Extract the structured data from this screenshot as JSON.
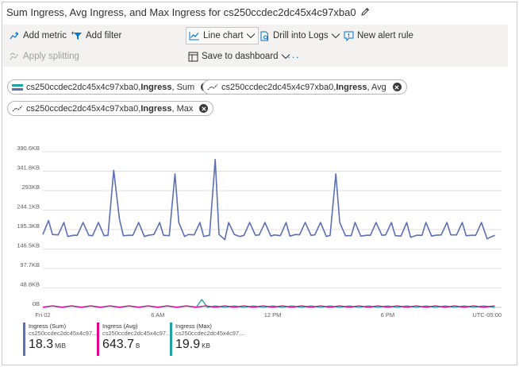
{
  "header": {
    "title": "Sum Ingress, Avg Ingress, and Max Ingress for cs250ccdec2dc45x4c97xba0"
  },
  "toolbar": {
    "add_metric": "Add metric",
    "add_filter": "Add filter",
    "apply_splitting": "Apply splitting",
    "line_chart": "Line chart",
    "drill_into_logs": "Drill into Logs",
    "new_alert_rule": "New alert rule",
    "save_to_dashboard": "Save to dashboard",
    "more": "···"
  },
  "pills": [
    {
      "resource": "cs250ccdec2dc45x4c97xba0, ",
      "metric": "Ingress",
      "agg": ", Sum"
    },
    {
      "resource": "cs250ccdec2dc45x4c97xba0, ",
      "metric": "Ingress",
      "agg": ", Avg"
    },
    {
      "resource": "cs250ccdec2dc45x4c97xba0, ",
      "metric": "Ingress",
      "agg": ", Max"
    }
  ],
  "colors": {
    "sum": "#5b6fb4",
    "avg": "#e3008c",
    "max": "#1ea3a3",
    "accent": "#0078d4"
  },
  "chart_data": {
    "type": "line",
    "y_ticks": [
      "390.6KB",
      "341.8KB",
      "293KB",
      "244.1KB",
      "195.3KB",
      "146.5KB",
      "97.7KB",
      "48.8KB",
      "0B"
    ],
    "y_tick_values": [
      390.6,
      341.8,
      293,
      244.1,
      195.3,
      146.5,
      97.7,
      48.8,
      0
    ],
    "ylim": [
      0,
      390.6
    ],
    "y_unit": "KB",
    "x_ticks": [
      {
        "label": "Fri 02",
        "hour": 0
      },
      {
        "label": "6 AM",
        "hour": 6
      },
      {
        "label": "12 PM",
        "hour": 12
      },
      {
        "label": "6 PM",
        "hour": 18
      }
    ],
    "xlim_hours": [
      0,
      23.95
    ],
    "timezone": "UTC-05:00",
    "grid": true,
    "series": [
      {
        "name": "Ingress (Sum)",
        "x": [
          0.0,
          0.3,
          0.5,
          0.8,
          1.1,
          1.3,
          1.6,
          1.8,
          2.1,
          2.4,
          2.6,
          2.9,
          3.2,
          3.4,
          3.7,
          4.0,
          4.2,
          4.5,
          4.7,
          5.0,
          5.3,
          5.5,
          5.8,
          6.1,
          6.3,
          6.6,
          6.9,
          7.1,
          7.4,
          7.6,
          7.9,
          8.2,
          8.4,
          8.7,
          9.0,
          9.2,
          9.5,
          9.7,
          10.0,
          10.3,
          10.5,
          10.8,
          11.1,
          11.3,
          11.6,
          11.9,
          12.1,
          12.4,
          12.7,
          12.9,
          13.2,
          13.4,
          13.7,
          14.0,
          14.2,
          14.5,
          14.8,
          15.0,
          15.3,
          15.5,
          15.8,
          16.1,
          16.3,
          16.6,
          16.9,
          17.1,
          17.4,
          17.7,
          17.9,
          18.2,
          18.4,
          18.7,
          19.0,
          19.2,
          19.5,
          19.8,
          20.0,
          20.3,
          20.5,
          20.8,
          21.1,
          21.3,
          21.6,
          21.9,
          22.1,
          22.4,
          22.6,
          22.9,
          23.2,
          23.4,
          23.6
        ],
        "y": [
          183,
          218,
          183,
          182,
          213,
          178,
          181,
          181,
          213,
          181,
          180,
          213,
          180,
          181,
          344,
          222,
          180,
          181,
          181,
          213,
          178,
          181,
          183,
          213,
          181,
          180,
          335,
          213,
          178,
          183,
          182,
          213,
          178,
          181,
          371,
          183,
          170,
          213,
          183,
          178,
          181,
          213,
          181,
          182,
          213,
          179,
          182,
          180,
          213,
          179,
          183,
          182,
          213,
          181,
          182,
          213,
          178,
          181,
          335,
          213,
          180,
          180,
          213,
          179,
          181,
          181,
          213,
          181,
          182,
          213,
          180,
          179,
          213,
          176,
          181,
          181,
          213,
          179,
          181,
          182,
          213,
          182,
          182,
          213,
          180,
          181,
          181,
          213,
          172,
          177,
          181
        ],
        "value": "18.3",
        "unit": "MiB",
        "sub": "cs250ccdec2dc45x4c97..."
      },
      {
        "name": "Ingress (Avg)",
        "x": [
          0.0,
          0.5,
          1.0,
          1.5,
          2.0,
          2.5,
          3.0,
          3.5,
          4.0,
          4.5,
          5.0,
          5.5,
          6.0,
          6.5,
          7.0,
          7.5,
          8.0,
          8.5,
          9.0,
          9.5,
          10.0,
          10.5,
          11.0,
          11.5,
          12.0,
          12.5,
          13.0,
          13.5,
          14.0,
          14.5,
          15.0,
          15.5,
          16.0,
          16.5,
          17.0,
          17.5,
          18.0,
          18.5,
          19.0,
          19.5,
          20.0,
          20.5,
          21.0,
          21.5,
          22.0,
          22.5,
          23.0,
          23.6
        ],
        "y": [
          0.6,
          4,
          0.6,
          4,
          0.6,
          4,
          0.6,
          4,
          0.6,
          4,
          0.6,
          4,
          0.6,
          4,
          0.6,
          4,
          0.6,
          4,
          0.6,
          4,
          0.6,
          4,
          0.6,
          4,
          0.6,
          4,
          0.6,
          4,
          0.6,
          4,
          0.6,
          4,
          0.6,
          4,
          0.6,
          4,
          0.6,
          4,
          0.6,
          4,
          0.6,
          4,
          0.6,
          4,
          0.6,
          4,
          0.6,
          4
        ],
        "value": "643.7",
        "unit": "B",
        "sub": "cs250ccdec2dc45x4c97..."
      },
      {
        "name": "Ingress (Max)",
        "x": [
          0.0,
          0.5,
          1.0,
          1.5,
          2.0,
          2.5,
          3.0,
          3.5,
          4.0,
          4.5,
          5.0,
          5.5,
          6.0,
          6.5,
          7.0,
          7.5,
          8.0,
          8.3,
          8.6,
          9.0,
          9.5,
          10.0,
          10.5,
          11.0,
          11.5,
          12.0,
          12.5,
          13.0,
          13.5,
          14.0,
          14.5,
          15.0,
          15.5,
          16.0,
          16.5,
          17.0,
          17.5,
          18.0,
          18.5,
          19.0,
          19.5,
          20.0,
          20.5,
          21.0,
          21.5,
          22.0,
          22.5,
          23.0,
          23.6
        ],
        "y": [
          0,
          4,
          0,
          4,
          0,
          4,
          0,
          4,
          0,
          4,
          0,
          4,
          0,
          4,
          0,
          4,
          0,
          20,
          0,
          4,
          0,
          4,
          0,
          4,
          0,
          4,
          0,
          4,
          0,
          4,
          0,
          4,
          0,
          4,
          0,
          4,
          0,
          4,
          0,
          4,
          0,
          4,
          0,
          4,
          0,
          4,
          0,
          4,
          0
        ],
        "value": "19.9",
        "unit": "KB",
        "sub": "cs250ccdec2dc45x4c97..."
      }
    ]
  }
}
